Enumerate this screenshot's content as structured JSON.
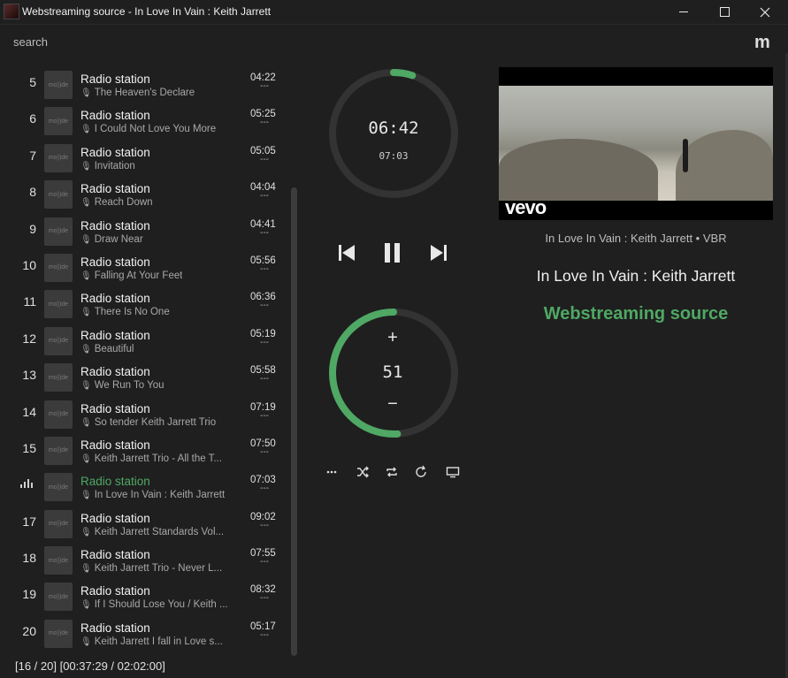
{
  "window": {
    "title": "Webstreaming source - In Love In Vain : Keith Jarrett"
  },
  "search": {
    "label": "search"
  },
  "logo": "m",
  "playlist": [
    {
      "num": "5",
      "station": "Radio station",
      "track": "The Heaven's Declare",
      "duration": "04:22",
      "sub": "---"
    },
    {
      "num": "6",
      "station": "Radio station",
      "track": "I Could Not Love You More",
      "duration": "05:25",
      "sub": "---"
    },
    {
      "num": "7",
      "station": "Radio station",
      "track": "Invitation",
      "duration": "05:05",
      "sub": "---"
    },
    {
      "num": "8",
      "station": "Radio station",
      "track": "Reach Down",
      "duration": "04:04",
      "sub": "---"
    },
    {
      "num": "9",
      "station": "Radio station",
      "track": "Draw Near",
      "duration": "04:41",
      "sub": "---"
    },
    {
      "num": "10",
      "station": "Radio station",
      "track": "Falling At Your Feet",
      "duration": "05:56",
      "sub": "---"
    },
    {
      "num": "11",
      "station": "Radio station",
      "track": "There Is No One",
      "duration": "06:36",
      "sub": "---"
    },
    {
      "num": "12",
      "station": "Radio station",
      "track": "Beautiful",
      "duration": "05:19",
      "sub": "---"
    },
    {
      "num": "13",
      "station": "Radio station",
      "track": "We Run To You",
      "duration": "05:58",
      "sub": "---"
    },
    {
      "num": "14",
      "station": "Radio station",
      "track": "So tender Keith Jarrett Trio",
      "duration": "07:19",
      "sub": "---"
    },
    {
      "num": "15",
      "station": "Radio station",
      "track": "Keith Jarrett Trio - All the T...",
      "duration": "07:50",
      "sub": "---"
    },
    {
      "num": "",
      "station": "Radio station",
      "track": "In Love In Vain : Keith Jarrett",
      "duration": "07:03",
      "sub": "---",
      "active": true
    },
    {
      "num": "17",
      "station": "Radio station",
      "track": "Keith Jarrett Standards Vol...",
      "duration": "09:02",
      "sub": "---"
    },
    {
      "num": "18",
      "station": "Radio station",
      "track": "Keith Jarrett Trio - Never L...",
      "duration": "07:55",
      "sub": "---"
    },
    {
      "num": "19",
      "station": "Radio station",
      "track": "If I Should Lose You / Keith ...",
      "duration": "08:32",
      "sub": "---"
    },
    {
      "num": "20",
      "station": "Radio station",
      "track": "Keith Jarrett I fall in Love s...",
      "duration": "05:17",
      "sub": "---"
    }
  ],
  "thumb_text": "mo))de",
  "status": "[16 / 20] [00:37:29 / 02:02:00]",
  "player": {
    "elapsed": "06:42",
    "total": "07:03",
    "progress": 0.05,
    "volume": "51",
    "volume_level": 0.51,
    "plus": "+",
    "minus": "−"
  },
  "now_playing": {
    "info": "In Love In Vain : Keith Jarrett • VBR",
    "title": "In Love In Vain : Keith Jarrett",
    "source": "Webstreaming source",
    "video_logo": "vevo"
  },
  "colors": {
    "accent": "#4fa864",
    "ring_track": "#333333",
    "background": "#1f1f1f"
  },
  "icons": {
    "prev": "skip-previous-icon",
    "pause": "pause-icon",
    "next": "skip-next-icon",
    "more": "more-icon",
    "shuffle": "shuffle-icon",
    "repeat": "repeat-icon",
    "single": "repeat-one-icon",
    "screen": "screen-icon"
  }
}
